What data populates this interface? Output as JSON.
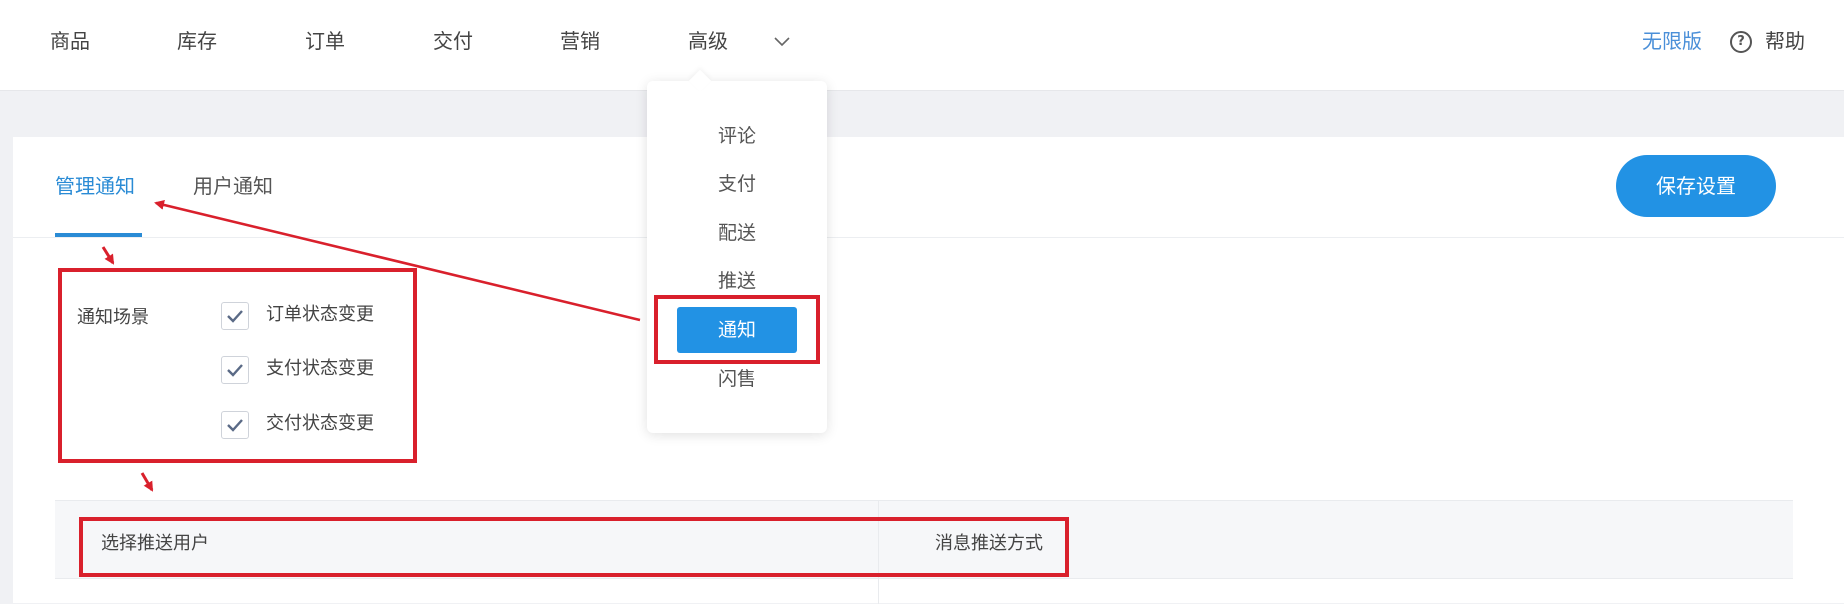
{
  "topnav": {
    "items": [
      {
        "label": "商品"
      },
      {
        "label": "库存"
      },
      {
        "label": "订单"
      },
      {
        "label": "交付"
      },
      {
        "label": "营销"
      },
      {
        "label": "高级"
      }
    ],
    "edition_label": "无限版",
    "help_label": "帮助",
    "help_icon": "question-circle-icon"
  },
  "advanced_menu": {
    "items": [
      {
        "label": "评论"
      },
      {
        "label": "支付"
      },
      {
        "label": "配送"
      },
      {
        "label": "推送"
      },
      {
        "label": "通知",
        "active": true
      },
      {
        "label": "闪售"
      }
    ]
  },
  "tabs": [
    {
      "label": "管理通知",
      "active": true
    },
    {
      "label": "用户通知",
      "active": false
    }
  ],
  "save_label": "保存设置",
  "notify_scene": {
    "label": "通知场景",
    "options": [
      {
        "label": "订单状态变更",
        "checked": true
      },
      {
        "label": "支付状态变更",
        "checked": true
      },
      {
        "label": "交付状态变更",
        "checked": true
      }
    ]
  },
  "table": {
    "headers": [
      "选择推送用户",
      "消息推送方式"
    ]
  },
  "colors": {
    "accent": "#2292e4",
    "annotation_red": "#d9202c",
    "link_blue": "#4a8fd8"
  }
}
